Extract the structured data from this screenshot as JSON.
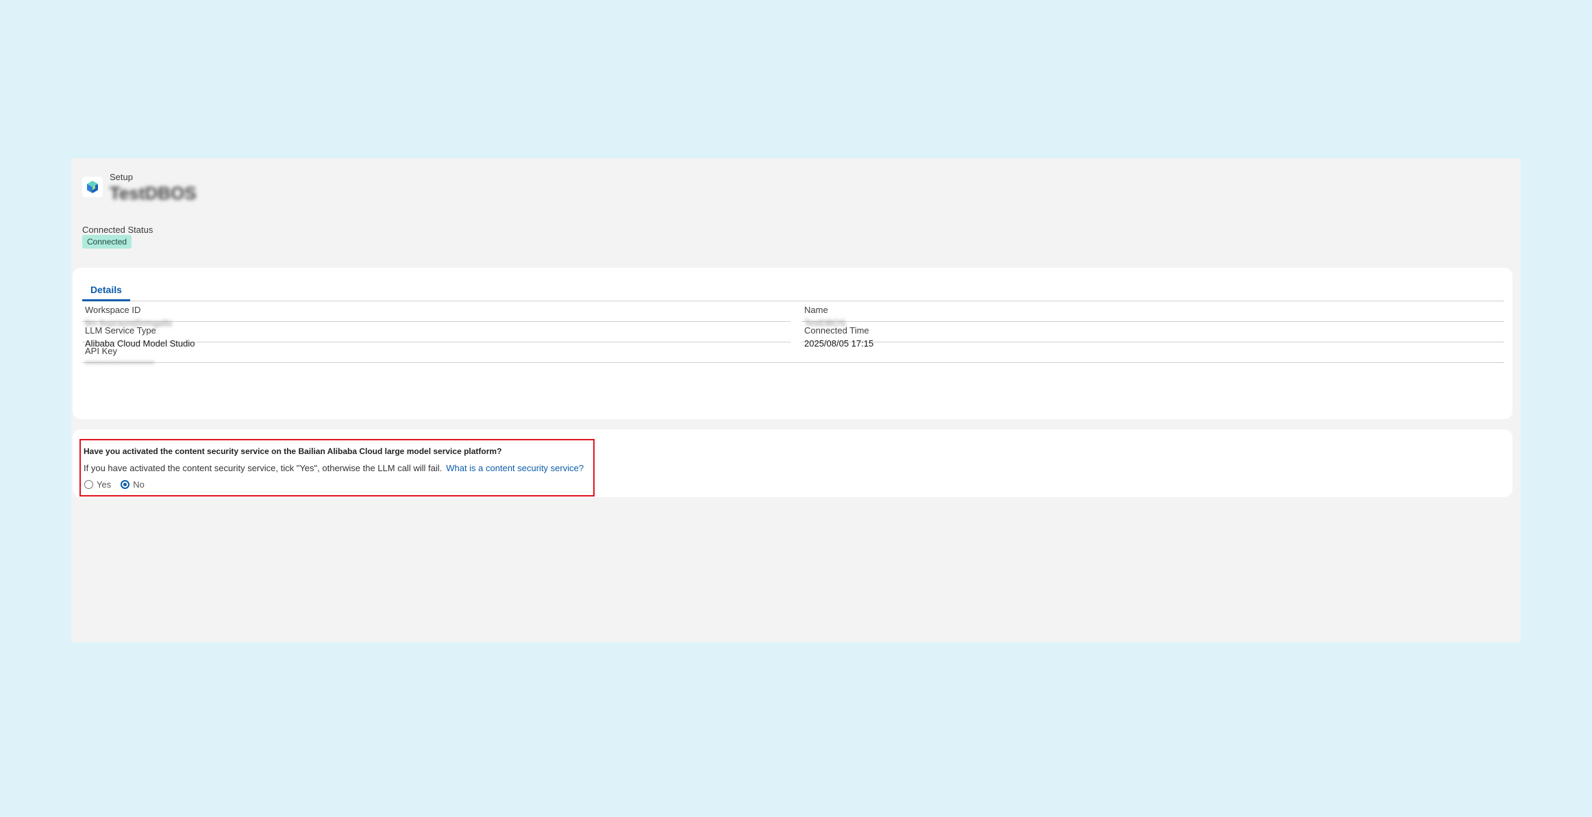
{
  "header": {
    "object_label": "Setup",
    "record_title": "TestDBOS",
    "status_label": "Connected Status",
    "status_value": "Connected"
  },
  "tabs": [
    {
      "label": "Details",
      "active": true
    }
  ],
  "details": {
    "workspace_id": {
      "label": "Workspace ID",
      "value": "llm-9xpcwzej5nmga9z"
    },
    "name": {
      "label": "Name",
      "value": "TestDBOS"
    },
    "llm_service_type": {
      "label": "LLM Service Type",
      "value": "Alibaba Cloud Model Studio"
    },
    "connected_time": {
      "label": "Connected Time",
      "value": "2025/08/05 17:15"
    },
    "api_key": {
      "label": "API Key",
      "value": "********************"
    }
  },
  "content_security": {
    "question": "Have you activated the content security service on the Bailian Alibaba Cloud large model service platform?",
    "help_text": "If you have activated the content security service, tick \"Yes\", otherwise the LLM call will fail.",
    "help_link": "What is a content security service?",
    "options": [
      {
        "label": "Yes",
        "selected": false
      },
      {
        "label": "No",
        "selected": true
      }
    ]
  },
  "colors": {
    "page_background": "#ddf3f9",
    "panel_background": "#f3f3f3",
    "accent": "#0b5cab",
    "status_badge": "#afeadd",
    "highlight_border": "#e0141e"
  },
  "icons": {
    "app_logo": "cube-logo-icon"
  }
}
